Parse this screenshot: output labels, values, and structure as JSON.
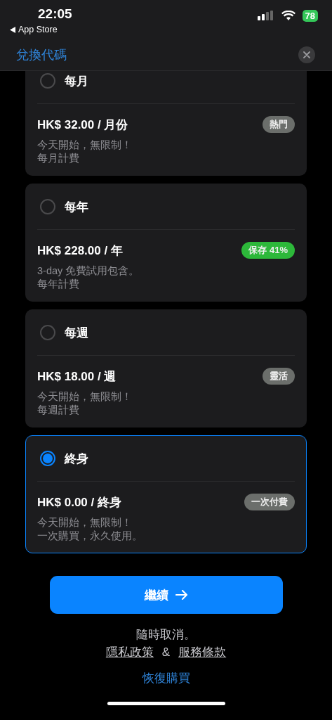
{
  "status_bar": {
    "time": "22:05",
    "back_label": "App Store",
    "battery": "78"
  },
  "header": {
    "redeem_link": "兌換代碼"
  },
  "plans": [
    {
      "name": "每月",
      "selected": false,
      "price": "HK$ 32.00 / 月份",
      "badge": {
        "label": "熱門",
        "color": "#6b6e6b"
      },
      "lines": [
        "今天開始，無限制！",
        "每月計費"
      ]
    },
    {
      "name": "每年",
      "selected": false,
      "price": "HK$ 228.00 / 年",
      "badge": {
        "label": "保存 41%",
        "color": "#2db83a"
      },
      "lines": [
        "3-day 免費試用包含。",
        "每年計費"
      ]
    },
    {
      "name": "每週",
      "selected": false,
      "price": "HK$ 18.00 / 週",
      "badge": {
        "label": "靈活",
        "color": "#6b6e6b"
      },
      "lines": [
        "今天開始，無限制！",
        "每週計費"
      ]
    },
    {
      "name": "終身",
      "selected": true,
      "price": "HK$ 0.00 / 終身",
      "badge": {
        "label": "一次付費",
        "color": "#6b6e6b"
      },
      "lines": [
        "今天開始，無限制！",
        "一次購買，永久使用。"
      ]
    }
  ],
  "continue_button": "繼續",
  "footer": {
    "cancel_note": "隨時取消。",
    "privacy_link": "隱私政策",
    "separator": "&",
    "terms_link": "服務條款",
    "restore_link": "恢復購買"
  }
}
